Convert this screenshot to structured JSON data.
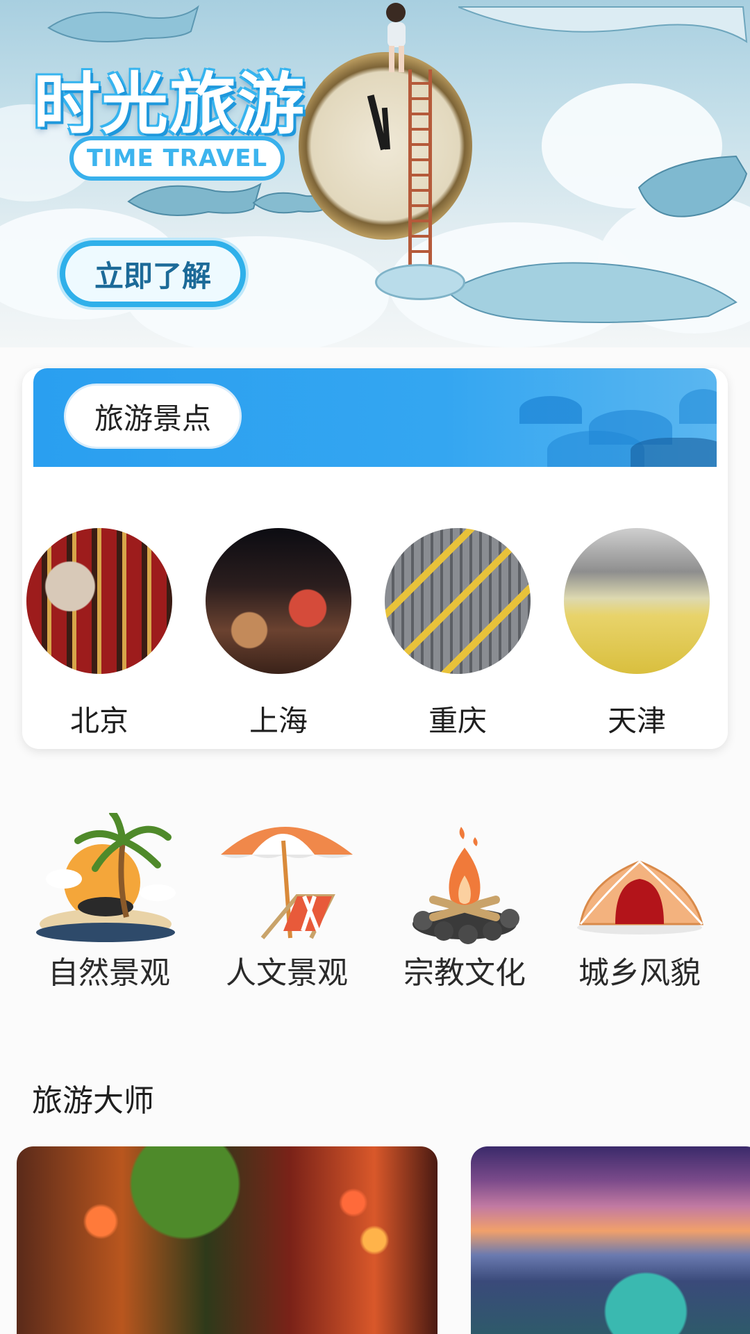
{
  "hero": {
    "title": "时光旅游",
    "subtitle": "TIME TRAVEL",
    "cta_label": "立即了解"
  },
  "spots": {
    "header_label": "旅游景点",
    "cities": [
      {
        "name": "北京"
      },
      {
        "name": "上海"
      },
      {
        "name": "重庆"
      },
      {
        "name": "天津"
      }
    ]
  },
  "categories": [
    {
      "label": "自然景观",
      "icon": "palm-island-icon"
    },
    {
      "label": "人文景观",
      "icon": "beach-umbrella-icon"
    },
    {
      "label": "宗教文化",
      "icon": "campfire-icon"
    },
    {
      "label": "城乡风貌",
      "icon": "tent-icon"
    }
  ],
  "masters": {
    "title": "旅游大师"
  },
  "colors": {
    "accent": "#2a9ff0",
    "hero_sky": "#a8cfe0",
    "text": "#1e1e1e"
  }
}
